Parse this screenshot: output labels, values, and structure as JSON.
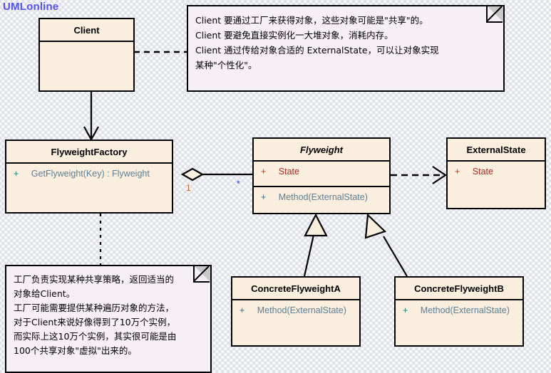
{
  "logo": {
    "text": "UMLonline"
  },
  "colors": {
    "class_fill": "#faeede",
    "note_fill": "#f6eff5",
    "border": "#000000",
    "logo": "#5353e8",
    "attribute_text": "#9c2b1f",
    "method_text": "#5f7d92",
    "visibility_method": "#1a7b7b",
    "visibility_attribute": "#b03a2e",
    "multiplicity_one": "#c46a21",
    "multiplicity_many": "#4a6fd4"
  },
  "classes": {
    "client": {
      "name": "Client",
      "abstract": false,
      "attributes": [],
      "methods": []
    },
    "flyweight_factory": {
      "name": "FlyweightFactory",
      "abstract": false,
      "attributes": [],
      "methods": [
        {
          "visibility": "+",
          "text": "GetFlyweight(Key) : Flyweight"
        }
      ]
    },
    "flyweight": {
      "name": "Flyweight",
      "abstract": true,
      "attributes": [
        {
          "visibility": "+",
          "text": "State"
        }
      ],
      "methods": [
        {
          "visibility": "+",
          "text": "Method(ExternalState)"
        }
      ]
    },
    "external_state": {
      "name": "ExternalState",
      "abstract": false,
      "attributes": [
        {
          "visibility": "+",
          "text": "State"
        }
      ],
      "methods": []
    },
    "concrete_flyweight_a": {
      "name": "ConcreteFlyweightA",
      "abstract": false,
      "attributes": [],
      "methods": [
        {
          "visibility": "+",
          "text": "Method(ExternalState)"
        }
      ]
    },
    "concrete_flyweight_b": {
      "name": "ConcreteFlyweightB",
      "abstract": false,
      "attributes": [],
      "methods": [
        {
          "visibility": "+",
          "text": "Method(ExternalState)"
        }
      ]
    }
  },
  "notes": {
    "client_note": {
      "text": "Client 要通过工厂来获得对象，这些对象可能是\"共享\"的。\nClient 要避免直接实例化一大堆对象，消耗内存。\nClient 通过传给对象合适的 ExternalState，可以让对象实现\n某种\"个性化\"。"
    },
    "factory_note": {
      "text": "工厂负责实现某种共享策略，返回适当的\n对象给Client。\n工厂可能需要提供某种遍历对象的方法，\n对于Client来说好像得到了10万个实例，\n而实际上这10万个实例，其实很可能是由\n100个共享对象\"虚拟\"出来的。"
    }
  },
  "relations": {
    "aggregation_source_multiplicity": "1",
    "aggregation_target_multiplicity": "*"
  }
}
